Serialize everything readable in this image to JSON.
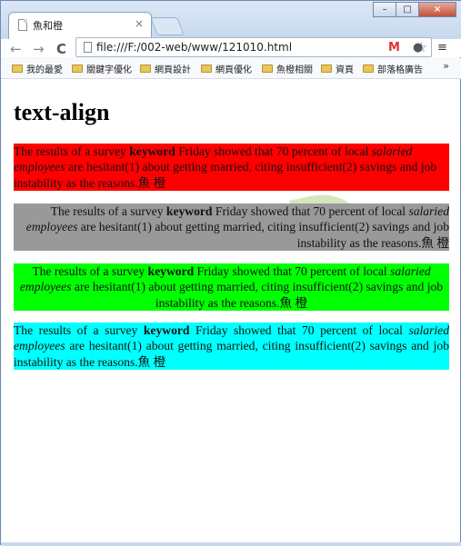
{
  "browser": {
    "tab_title": "魚和橙",
    "tab_close": "×",
    "url": "file:///F:/002-web/www/121010.html",
    "nav": {
      "back": "←",
      "forward": "→",
      "reload": "C"
    },
    "window_controls": {
      "minimize": "–",
      "maximize": "□",
      "close": "×"
    },
    "bookmarks": [
      "我的最愛",
      "關鍵字優化",
      "網頁設計",
      "網頁優化",
      "魚橙相關",
      "資頁",
      "部落格廣告"
    ],
    "bookmarks_more": "»",
    "icons": [
      "document-icon",
      "star-icon",
      "gmail-icon",
      "extension-icon",
      "menu-icon"
    ]
  },
  "page": {
    "heading": "text-align",
    "colors": {
      "red": "#ff0000",
      "gray": "#999999",
      "green": "#00ff00",
      "cyan": "#00ffff"
    },
    "paragraph": {
      "part1": "The results of a survey ",
      "keyword": "keyword",
      "part2": " Friday showed that 70 percent of local ",
      "salaried": "salaried employees",
      "part3": " are hesitant(1) about getting married, citing insufficient(2) savings and job instability as the reasons.",
      "cjk": "魚 橙"
    }
  }
}
